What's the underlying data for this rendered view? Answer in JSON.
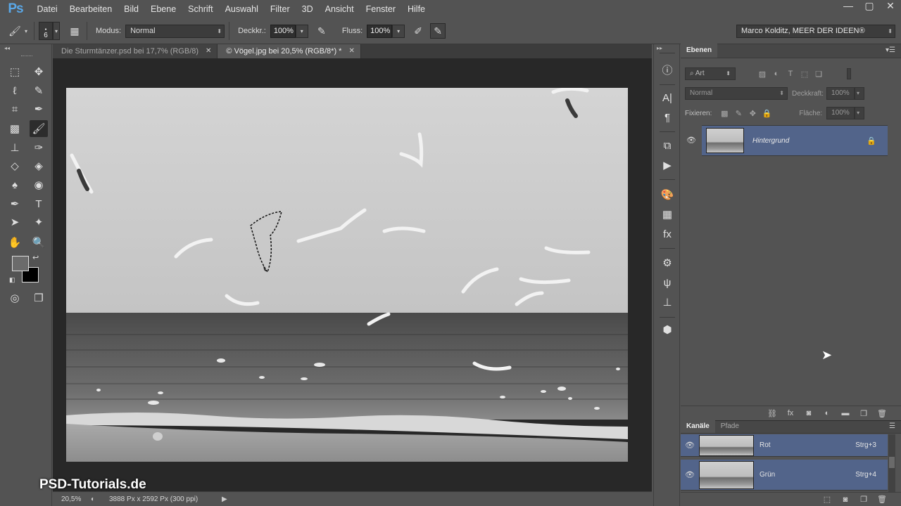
{
  "app": {
    "logo": "Ps"
  },
  "menu": [
    "Datei",
    "Bearbeiten",
    "Bild",
    "Ebene",
    "Schrift",
    "Auswahl",
    "Filter",
    "3D",
    "Ansicht",
    "Fenster",
    "Hilfe"
  ],
  "window_controls": {
    "minimize": "—",
    "maximize": "▢",
    "close": "✕"
  },
  "options": {
    "brush_size": "6",
    "mode_label": "Modus:",
    "mode_value": "Normal",
    "opacity_label": "Deckkr.:",
    "opacity_value": "100%",
    "flow_label": "Fluss:",
    "flow_value": "100%",
    "workspace": "Marco Kolditz, MEER DER IDEEN®"
  },
  "tabs": [
    {
      "label": "Die Sturmtänzer.psd bei 17,7% (RGB/8)",
      "close": "✕",
      "active": false
    },
    {
      "label": "© Vögel.jpg bei 20,5% (RGB/8*) *",
      "close": "✕",
      "active": true
    }
  ],
  "status": {
    "zoom": "20,5%",
    "info": "3888 Px x 2592 Px (300 ppi)"
  },
  "watermark": "PSD-Tutorials.de",
  "layers_panel": {
    "tab": "Ebenen",
    "filter_kind": "Art",
    "blend_mode": "Normal",
    "opacity_label": "Deckkraft:",
    "opacity_value": "100%",
    "lock_label": "Fixieren:",
    "fill_label": "Fläche:",
    "fill_value": "100%",
    "layers": [
      {
        "name": "Hintergrund"
      }
    ]
  },
  "channels_panel": {
    "tabs": [
      "Kanäle",
      "Pfade"
    ],
    "channels": [
      {
        "name": "Rot",
        "shortcut": "Strg+3"
      },
      {
        "name": "Grün",
        "shortcut": "Strg+4"
      }
    ]
  },
  "colors": {
    "selection_blue": "#52648a",
    "ui_gray": "#535353",
    "canvas_bg": "#282828"
  }
}
